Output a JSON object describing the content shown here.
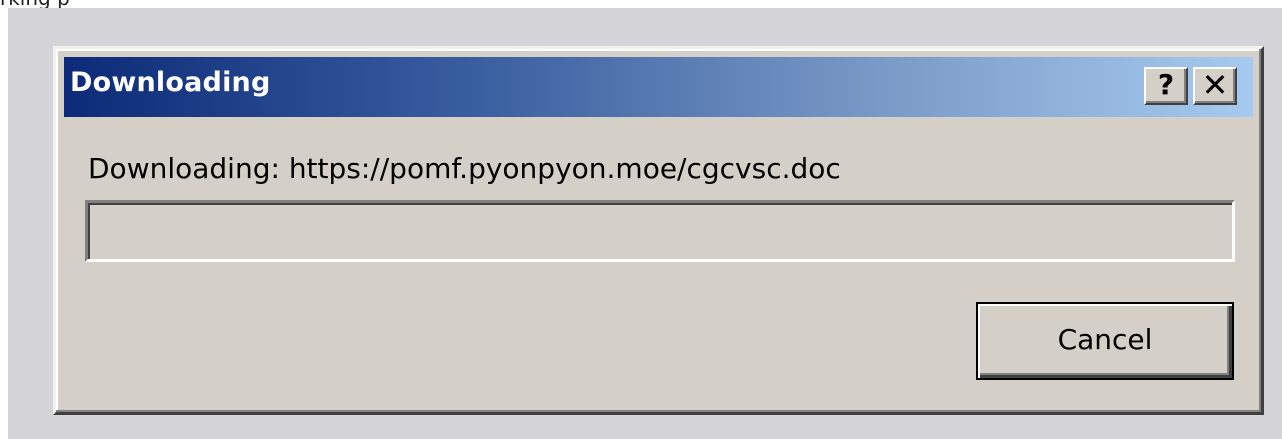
{
  "header_fragment": "rking p",
  "dialog": {
    "title": "Downloading",
    "help_label": "?",
    "close_label": "✕",
    "message": "Downloading: https://pomf.pyonpyon.moe/cgcvsc.doc",
    "progress": 0,
    "cancel_label": "Cancel"
  }
}
